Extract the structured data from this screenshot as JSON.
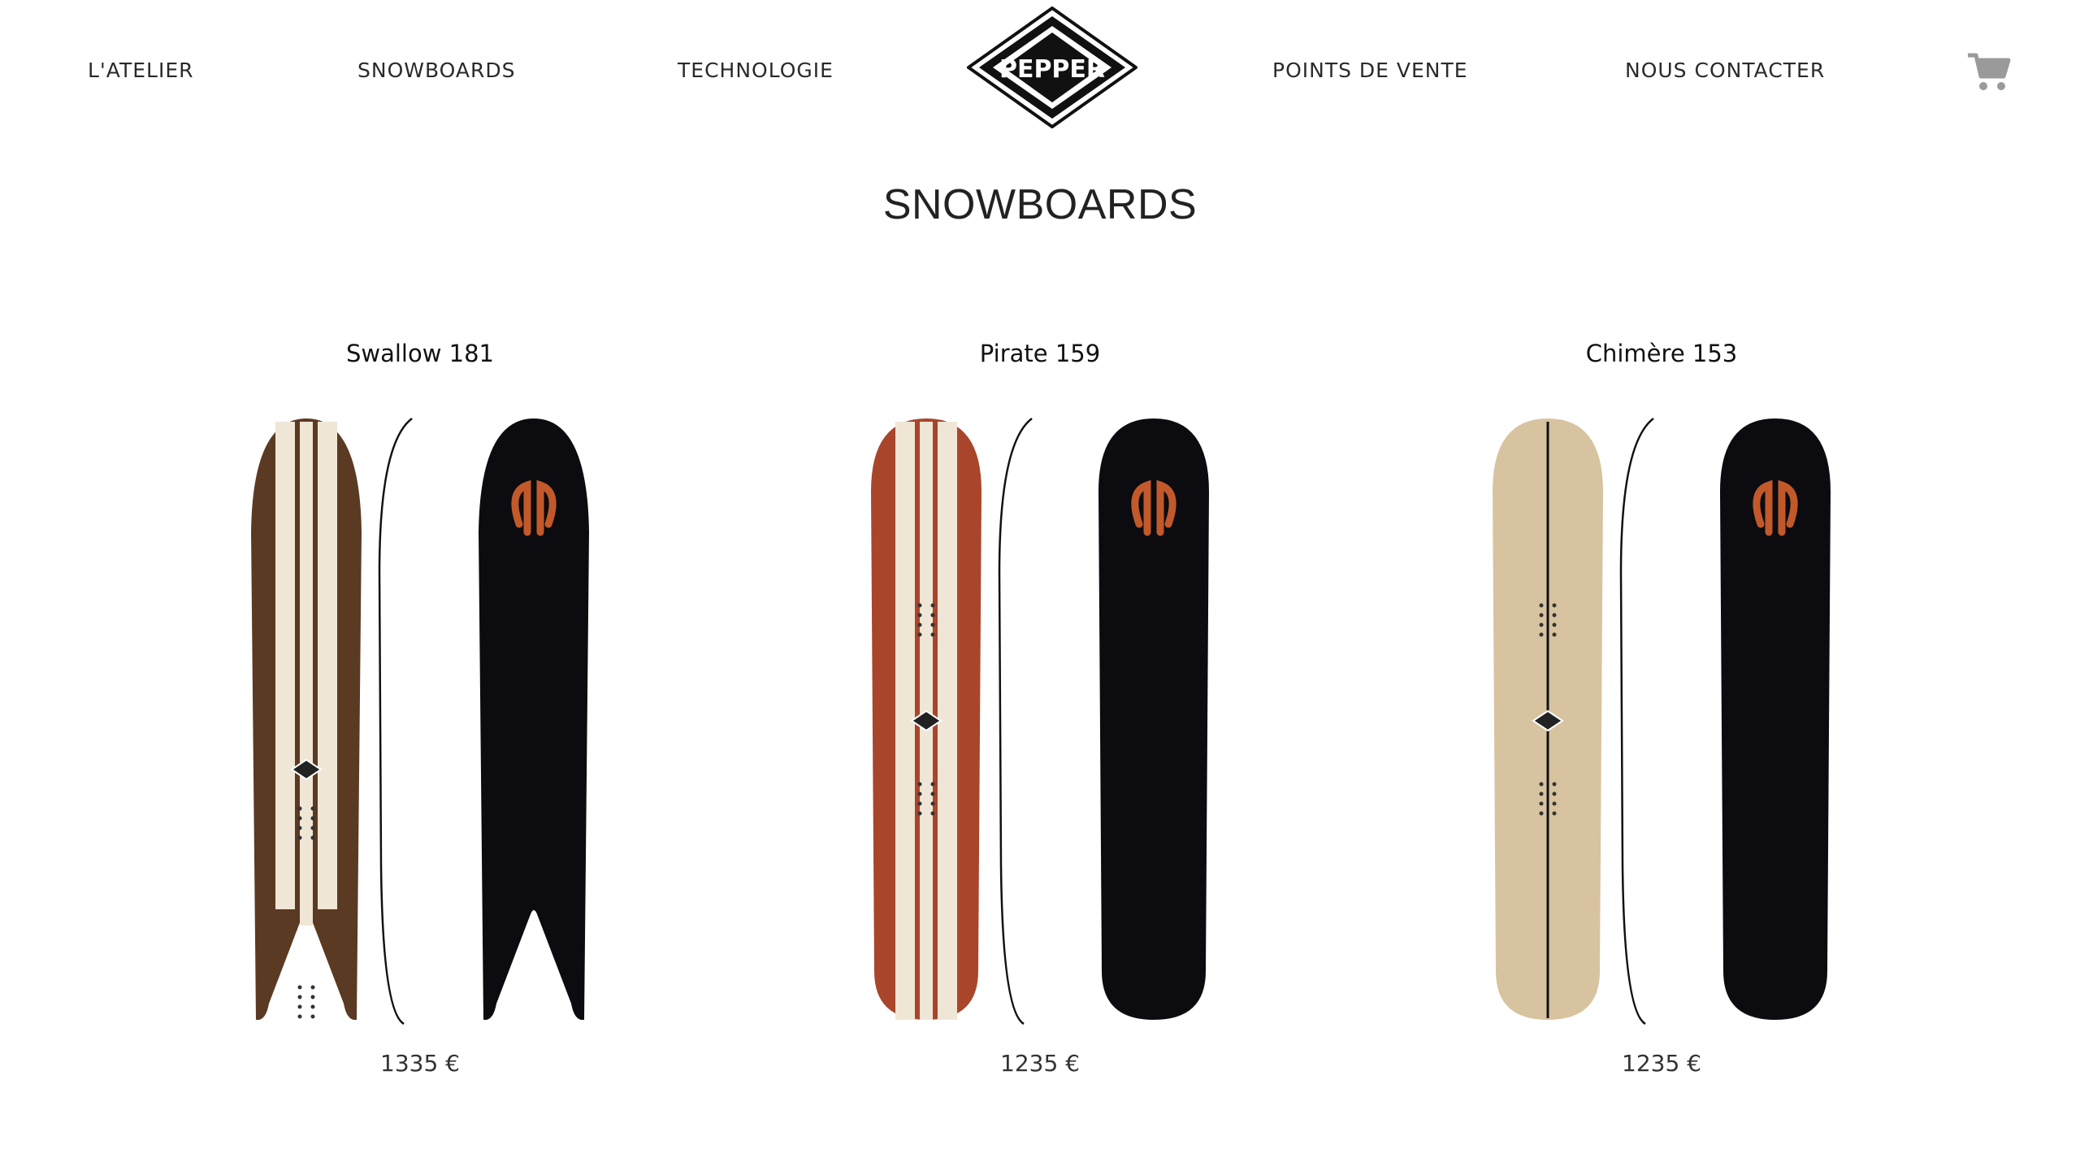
{
  "nav": {
    "left": [
      "L'ATELIER",
      "SNOWBOARDS",
      "TECHNOLOGIE"
    ],
    "right": [
      "POINTS DE VENTE",
      "NOUS CONTACTER"
    ],
    "logo_text": "PEPPER"
  },
  "page_title": "SNOWBOARDS",
  "products": [
    {
      "name": "Swallow 181",
      "price": "1335 €",
      "top_color": "#5a3a22",
      "shape": "swallow"
    },
    {
      "name": "Pirate 159",
      "price": "1235 €",
      "top_color": "#a9452a",
      "shape": "round"
    },
    {
      "name": "Chimère 153",
      "price": "1235 €",
      "top_color": "#d8c3a0",
      "shape": "round"
    }
  ],
  "colors": {
    "base_black": "#0b0b10",
    "logo_orange": "#c2592b",
    "stripe_cream": "#efe6d6"
  }
}
